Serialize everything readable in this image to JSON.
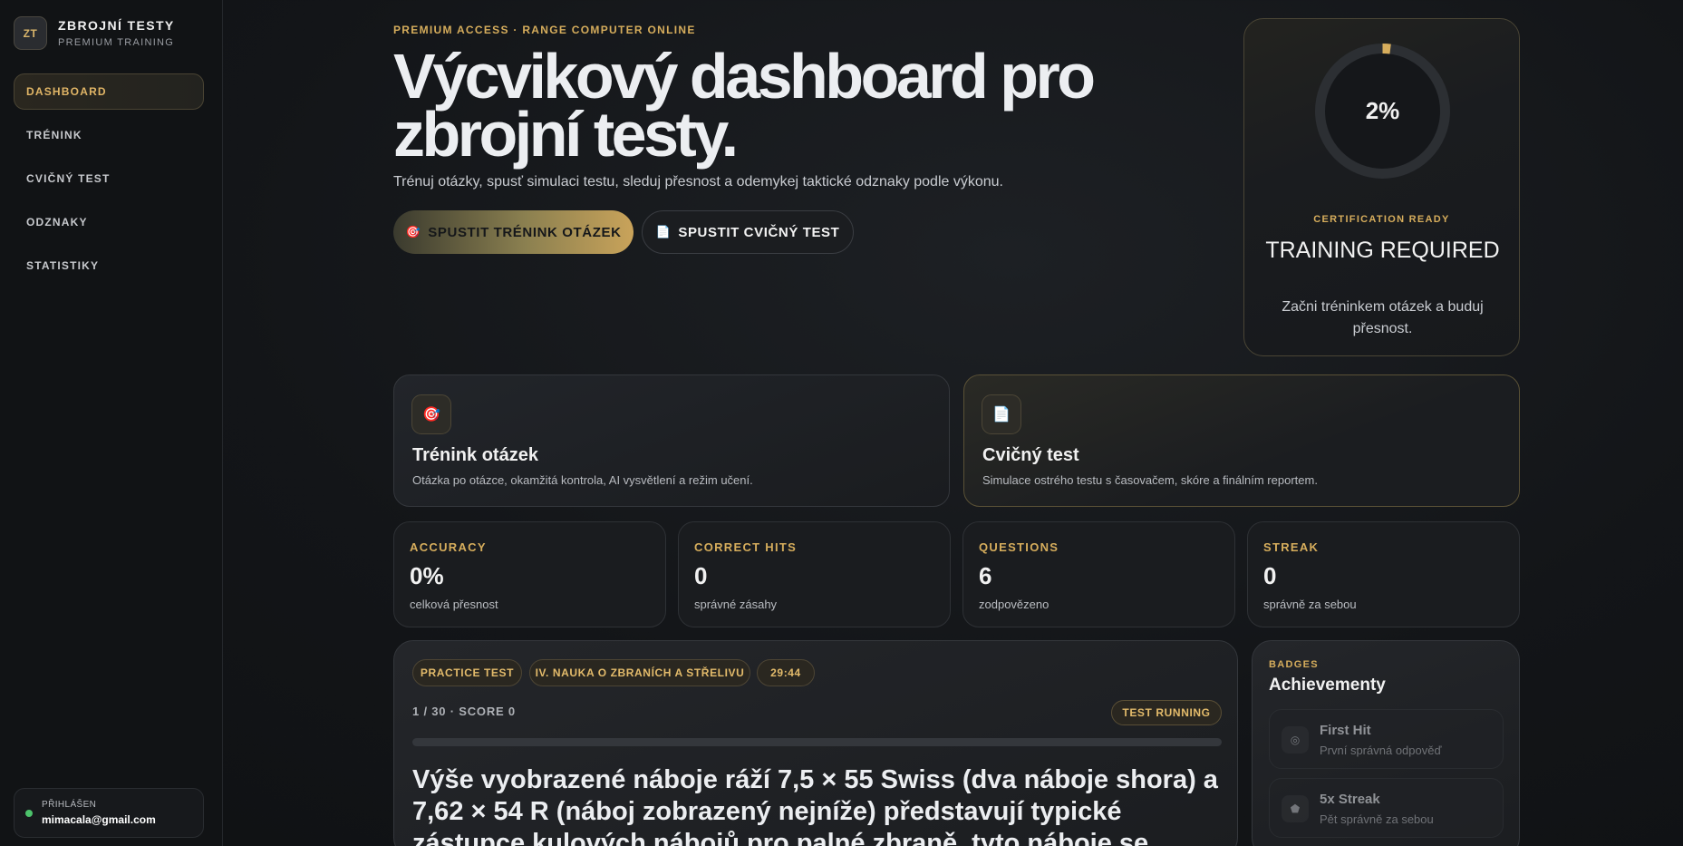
{
  "brand": {
    "initials": "ZT",
    "title": "ZBROJNÍ TESTY",
    "subtitle": "PREMIUM TRAINING"
  },
  "nav": {
    "items": [
      {
        "label": "DASHBOARD",
        "active": true
      },
      {
        "label": "TRÉNINK",
        "active": false
      },
      {
        "label": "CVIČNÝ TEST",
        "active": false
      },
      {
        "label": "ODZNAKY",
        "active": false
      },
      {
        "label": "STATISTIKY",
        "active": false
      }
    ]
  },
  "user": {
    "label": "PŘIHLÁŠEN",
    "email": "mimacala@gmail.com",
    "status_color": "#4cc36b"
  },
  "hero": {
    "kicker": "PREMIUM ACCESS · RANGE COMPUTER ONLINE",
    "title": "Výcvikový dashboard pro zbrojní testy.",
    "subtitle": "Trénuj otázky, spusť simulaci testu, sleduj přesnost a odemykej taktické odznaky podle výkonu.",
    "primary_button": "SPUSTIT TRÉNINK OTÁZEK",
    "primary_icon": "target-icon",
    "secondary_button": "SPUSTIT CVIČNÝ TEST",
    "secondary_icon": "document-icon"
  },
  "certification": {
    "progress_label": "2%",
    "progress_fraction": 0.02,
    "kicker": "CERTIFICATION READY",
    "title": "TRAINING REQUIRED",
    "description": "Začni tréninkem otázek a buduj přesnost."
  },
  "modes": [
    {
      "icon": "target-icon",
      "title": "Trénink otázek",
      "description": "Otázka po otázce, okamžitá kontrola, AI vysvětlení a režim učení."
    },
    {
      "icon": "document-icon",
      "title": "Cvičný test",
      "description": "Simulace ostrého testu s časovačem, skóre a finálním reportem."
    }
  ],
  "stats": [
    {
      "label": "ACCURACY",
      "value": "0%",
      "sub": "celková přesnost"
    },
    {
      "label": "CORRECT HITS",
      "value": "0",
      "sub": "správné zásahy"
    },
    {
      "label": "QUESTIONS",
      "value": "6",
      "sub": "zodpovězeno"
    },
    {
      "label": "STREAK",
      "value": "0",
      "sub": "správně za sebou"
    }
  ],
  "test": {
    "chips": [
      "PRACTICE TEST",
      "IV. NAUKA O ZBRANÍCH A STŘELIVU",
      "29:44"
    ],
    "meta": "1 / 30 · SCORE 0",
    "status": "TEST RUNNING",
    "progress_fraction": 0.0,
    "question": "Výše vyobrazené náboje ráží 7,5 × 55 Swiss (dva náboje shora) a 7,62 × 54 R (náboj zobrazený nejníže) představují typické zástupce kulových nábojů pro palné zbraně, tyto náboje se"
  },
  "badges": {
    "kicker": "BADGES",
    "title": "Achievementy",
    "items": [
      {
        "icon": "bullseye-icon",
        "name": "First Hit",
        "description": "První správná odpověď"
      },
      {
        "icon": "pentagon-icon",
        "name": "5x Streak",
        "description": "Pět správně za sebou"
      }
    ]
  },
  "colors": {
    "accent": "#d6ad5c",
    "background": "#131518",
    "text": "#eceef1"
  }
}
